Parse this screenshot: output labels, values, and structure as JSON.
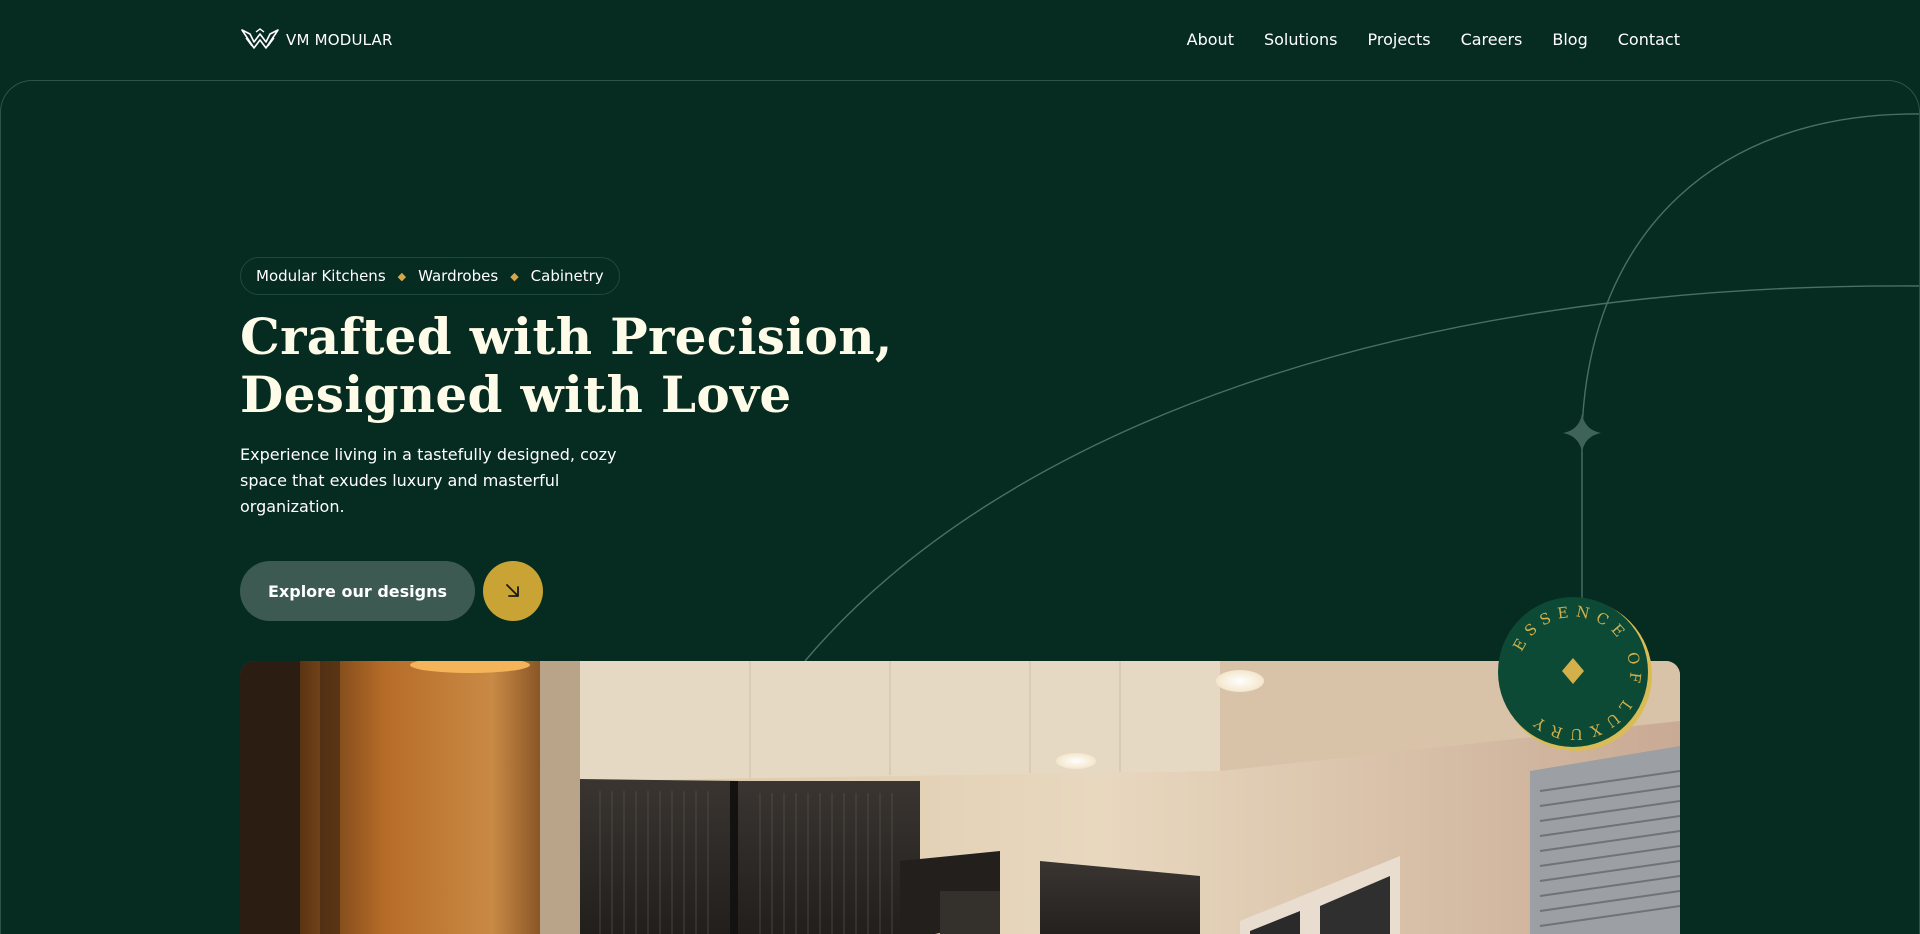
{
  "header": {
    "brand": "VM MODULAR",
    "logo_icon": "vm-modular-wings-logo",
    "nav": [
      "About",
      "Solutions",
      "Projects",
      "Careers",
      "Blog",
      "Contact"
    ]
  },
  "hero": {
    "tags": [
      "Modular Kitchens",
      "Wardrobes",
      "Cabinetry"
    ],
    "headline": "Crafted with Precision, Designed with Love",
    "subtext": "Experience living in a tastefully designed, cozy space that exudes luxury and masterful organization.",
    "cta_label": "Explore our designs",
    "cta_icon": "arrow-down-right-icon",
    "badge_text": "ESSENCE OF LUXURY",
    "image_alt": "Modular kitchen interior with dark fluted-glass cabinets"
  },
  "colors": {
    "background": "#062b20",
    "accent_gold": "#c9a435",
    "button_green": "#3c5a51",
    "badge_green": "#0c4a36"
  }
}
